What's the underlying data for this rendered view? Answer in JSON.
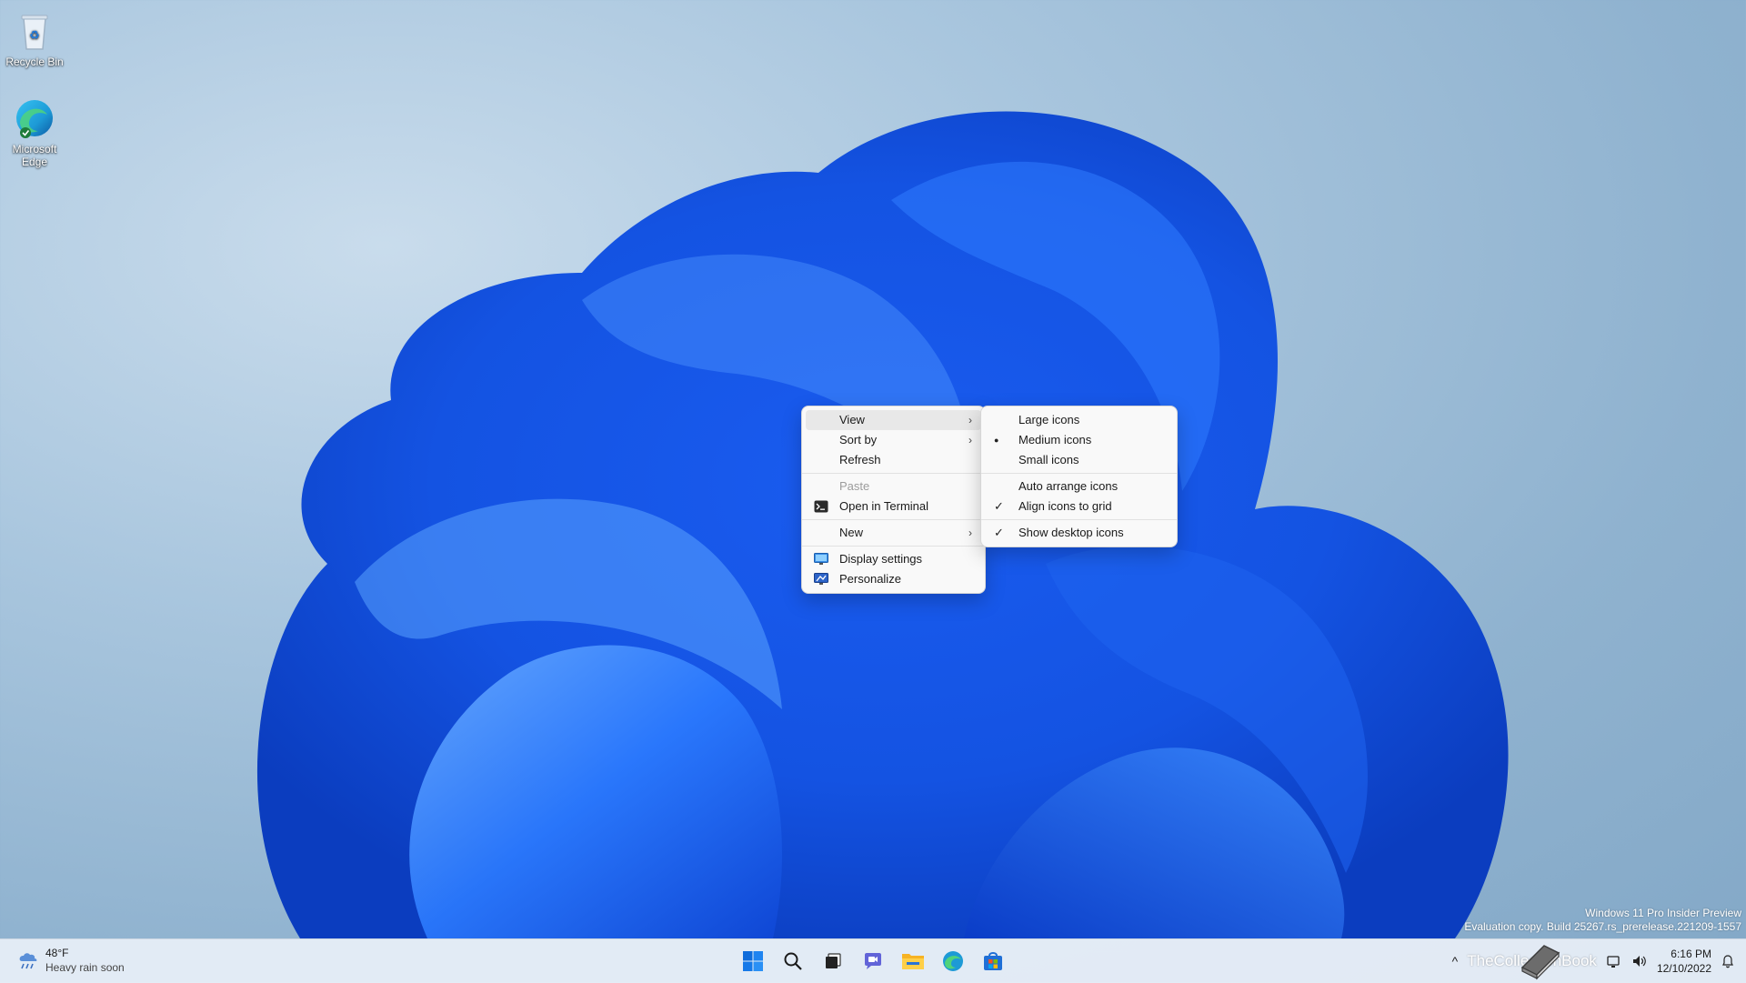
{
  "desktop": {
    "icons": [
      {
        "label": "Recycle Bin",
        "icon": "recycle-bin-icon"
      },
      {
        "label": "Microsoft Edge",
        "icon": "edge-icon"
      }
    ]
  },
  "context_menu": {
    "items": [
      {
        "label": "View",
        "submenu": true,
        "highlighted": true
      },
      {
        "label": "Sort by",
        "submenu": true
      },
      {
        "label": "Refresh"
      },
      {
        "label": "Paste",
        "disabled": true
      },
      {
        "label": "Open in Terminal",
        "icon": "terminal-icon"
      },
      {
        "label": "New",
        "submenu": true
      },
      {
        "label": "Display settings",
        "icon": "display-icon"
      },
      {
        "label": "Personalize",
        "icon": "personalize-icon"
      }
    ]
  },
  "view_submenu": {
    "items": [
      {
        "label": "Large icons",
        "mark": ""
      },
      {
        "label": "Medium icons",
        "mark": "●"
      },
      {
        "label": "Small icons",
        "mark": ""
      },
      {
        "label": "Auto arrange icons",
        "mark": ""
      },
      {
        "label": "Align icons to grid",
        "mark": "✓"
      },
      {
        "label": "Show desktop icons",
        "mark": "✓"
      }
    ]
  },
  "watermark": {
    "line1": "Windows 11 Pro Insider Preview",
    "line2": "Evaluation copy. Build 25267.rs_prerelease.221209-1557"
  },
  "taskbar": {
    "weather": {
      "temp": "48°F",
      "condition": "Heavy rain soon",
      "icon": "rain-cloud-icon"
    },
    "apps": [
      "start-icon",
      "search-icon",
      "task-view-icon",
      "teams-chat-icon",
      "file-explorer-icon",
      "edge-icon",
      "store-icon"
    ],
    "tray": {
      "chevron": "^",
      "time": "6:16 PM",
      "date": "12/10/2022",
      "overlay_text": "TheCollectionBook"
    }
  },
  "colors": {
    "menu_bg": "#f9f9f9",
    "highlight": "#e8e8e8",
    "accent": "#0067c0"
  }
}
